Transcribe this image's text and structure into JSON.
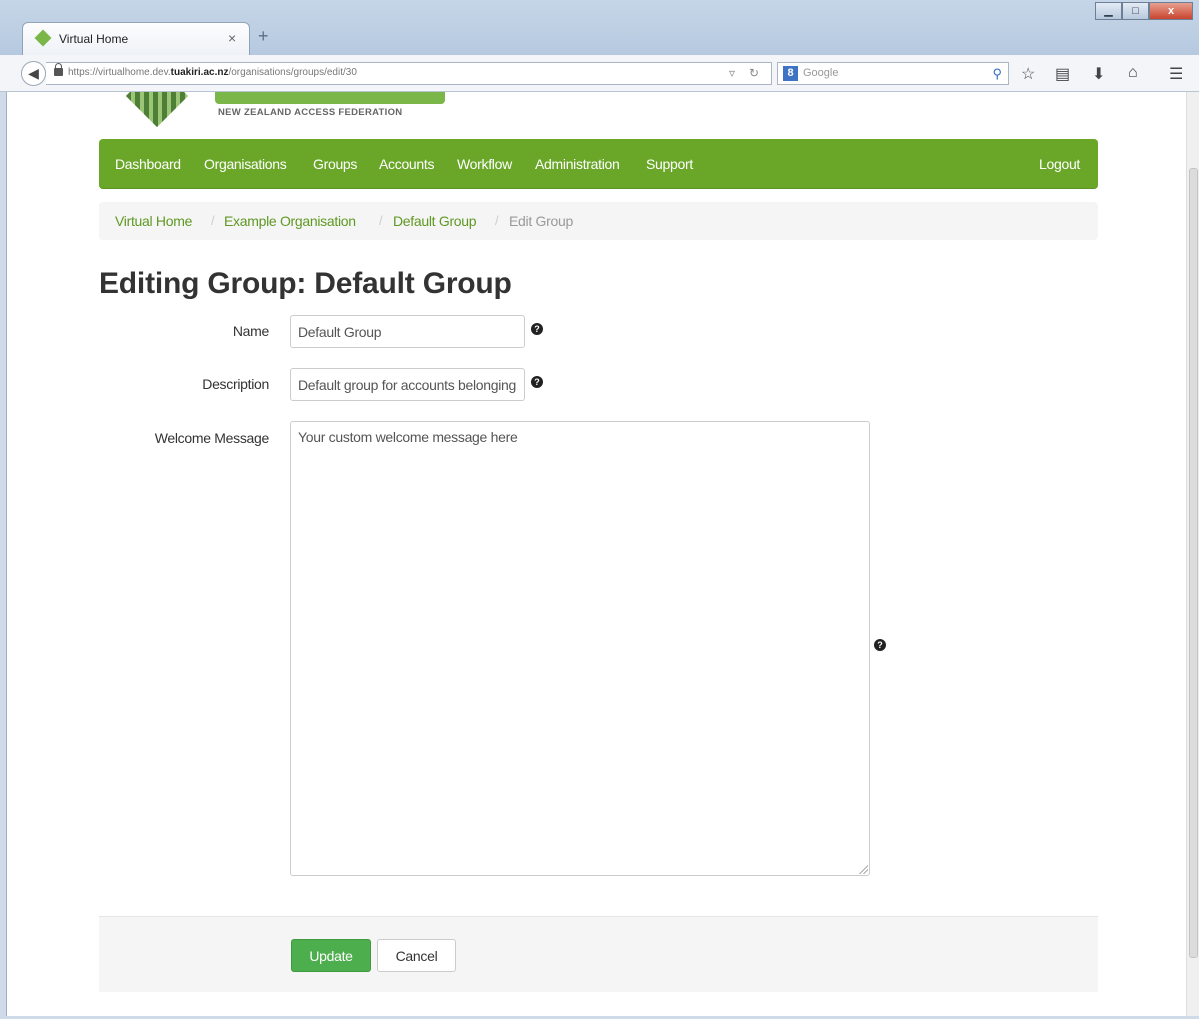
{
  "browser": {
    "tab_title": "Virtual Home",
    "tab_close": "×",
    "new_tab": "+",
    "url_prefix": "https://virtualhome.dev.",
    "url_domain": "tuakiri.ac.nz",
    "url_path": "/organisations/groups/edit/30",
    "search_engine_glyph": "8",
    "search_placeholder": "Google",
    "win_minimize": "▁",
    "win_maximize": "□",
    "win_close": "x",
    "icons": [
      "back-icon",
      "lock-icon",
      "reload-icon",
      "search-icon",
      "bookmark-star-icon",
      "clipboard-icon",
      "download-icon",
      "home-icon",
      "menu-icon"
    ]
  },
  "logo": {
    "subtitle": "NEW ZEALAND ACCESS FEDERATION",
    "brand_color": "#7ab648"
  },
  "nav": {
    "items": [
      "Dashboard",
      "Organisations",
      "Groups",
      "Accounts",
      "Workflow",
      "Administration",
      "Support"
    ],
    "logout": "Logout",
    "color": "#6aa628"
  },
  "breadcrumb": {
    "items": [
      "Virtual Home",
      "Example Organisation",
      "Default Group"
    ],
    "active": "Edit Group",
    "separator": "/"
  },
  "page": {
    "title": "Editing Group: Default Group"
  },
  "form": {
    "name_label": "Name",
    "name_value": "Default Group",
    "description_label": "Description",
    "description_value": "Default group for accounts belonging to Example Organisation",
    "welcome_label": "Welcome Message",
    "welcome_value": "Your custom welcome message here",
    "help_glyph": "?"
  },
  "actions": {
    "update": "Update",
    "cancel": "Cancel",
    "update_color": "#4cae4c"
  }
}
